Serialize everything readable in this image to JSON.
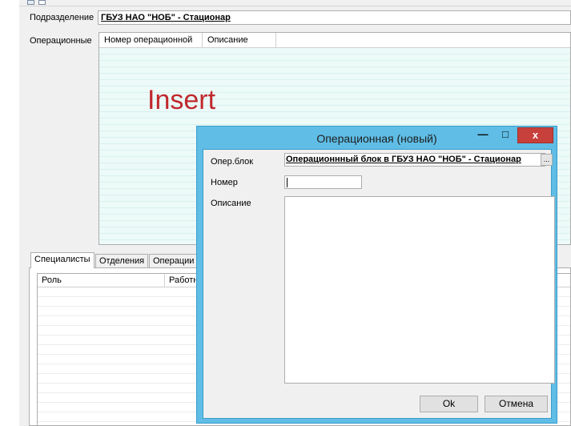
{
  "form": {
    "department_label": "Подразделение",
    "department_value": "ГБУЗ НАО \"НОБ\" - Стационар",
    "operating_label": "Операционные",
    "grid_columns": [
      "Номер операционной",
      "Описание"
    ]
  },
  "overlay_text": "Insert",
  "tabs": [
    "Специалисты",
    "Отделения",
    "Операции"
  ],
  "bottom_grid_columns": [
    "Роль",
    "Работн"
  ],
  "dialog": {
    "title": "Операционная (новый)",
    "min_glyph": "—",
    "max_glyph": "□",
    "close_glyph": "x",
    "oper_block_label": "Опер.блок",
    "oper_block_value": "Операционнный блок в ГБУЗ НАО \"НОБ\" - Стационар",
    "browse_glyph": "...",
    "number_label": "Номер",
    "number_value": "",
    "description_label": "Описание",
    "description_value": "",
    "ok_label": "Ok",
    "cancel_label": "Отмена"
  }
}
